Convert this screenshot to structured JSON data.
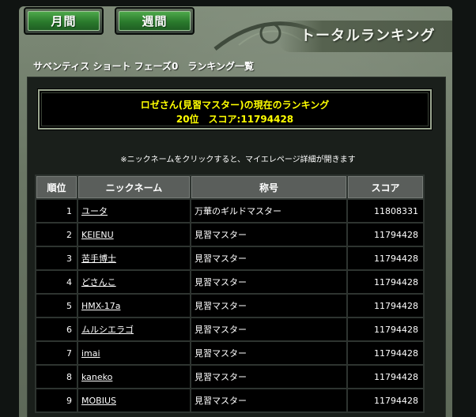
{
  "tabs": {
    "monthly_label": "月間",
    "weekly_label": "週間"
  },
  "header": {
    "title": "トータルランキング",
    "subtitle": "サベンティス ショート フェーズ0　ランキング一覧"
  },
  "my_rank": {
    "line1": "ロゼさん(見習マスター)の現在のランキング",
    "line2": "20位　スコア:11794428"
  },
  "note": "※ニックネームをクリックすると、マイエレページ詳細が開きます",
  "table": {
    "headers": {
      "rank": "順位",
      "nickname": "ニックネーム",
      "title": "称号",
      "score": "スコア"
    },
    "rows": [
      {
        "rank": "1",
        "nickname": "ユータ",
        "title": "万華のギルドマスター",
        "score": "11808331"
      },
      {
        "rank": "2",
        "nickname": "KEIENU",
        "title": "見習マスター",
        "score": "11794428"
      },
      {
        "rank": "3",
        "nickname": "苦手博士",
        "title": "見習マスター",
        "score": "11794428"
      },
      {
        "rank": "4",
        "nickname": "どさんこ",
        "title": "見習マスター",
        "score": "11794428"
      },
      {
        "rank": "5",
        "nickname": "HMX-17a",
        "title": "見習マスター",
        "score": "11794428"
      },
      {
        "rank": "6",
        "nickname": "ムルシエラゴ",
        "title": "見習マスター",
        "score": "11794428"
      },
      {
        "rank": "7",
        "nickname": "imai",
        "title": "見習マスター",
        "score": "11794428"
      },
      {
        "rank": "8",
        "nickname": "kaneko",
        "title": "見習マスター",
        "score": "11794428"
      },
      {
        "rank": "9",
        "nickname": "MOBIUS",
        "title": "見習マスター",
        "score": "11794428"
      }
    ]
  }
}
